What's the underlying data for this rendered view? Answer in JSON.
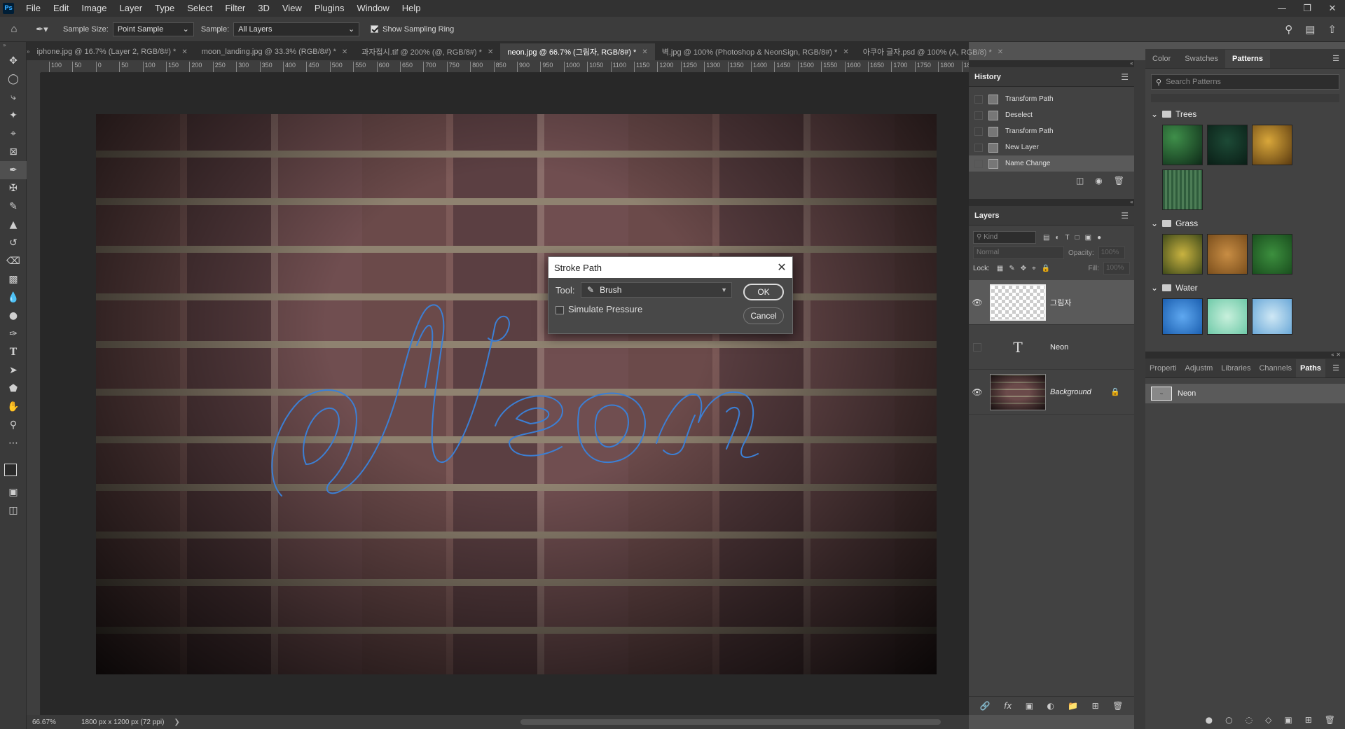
{
  "app": {
    "logo": "Ps"
  },
  "menu": [
    "File",
    "Edit",
    "Image",
    "Layer",
    "Type",
    "Select",
    "Filter",
    "3D",
    "View",
    "Plugins",
    "Window",
    "Help"
  ],
  "options": {
    "sample_size_label": "Sample Size:",
    "sample_size_value": "Point Sample",
    "sample_label": "Sample:",
    "sample_value": "All Layers",
    "show_sampling_ring": "Show Sampling Ring"
  },
  "tabs": [
    {
      "label": "iphone.jpg @ 16.7% (Layer 2, RGB/8#) *"
    },
    {
      "label": "moon_landing.jpg @ 33.3% (RGB/8#) *"
    },
    {
      "label": "과자접시.tif @ 200% (@, RGB/8#) *"
    },
    {
      "label": "neon.jpg @ 66.7% (그림자, RGB/8#) *"
    },
    {
      "label": "벽.jpg @ 100% (Photoshop & NeonSign, RGB/8#) *"
    },
    {
      "label": "아쿠아 글자.psd @ 100% (A, RGB/8) *"
    }
  ],
  "ruler_ticks": [
    "100",
    "50",
    "0",
    "50",
    "100",
    "150",
    "200",
    "250",
    "300",
    "350",
    "400",
    "450",
    "500",
    "550",
    "600",
    "650",
    "700",
    "750",
    "800",
    "850",
    "900",
    "950",
    "1000",
    "1050",
    "1100",
    "1150",
    "1200",
    "1250",
    "1300",
    "1350",
    "1400",
    "1450",
    "1500",
    "1550",
    "1600",
    "1650",
    "1700",
    "1750",
    "1800",
    "18"
  ],
  "status": {
    "zoom": "66.67%",
    "doc_size": "1800 px x 1200 px (72 ppi)"
  },
  "history": {
    "title": "History",
    "items": [
      "Transform Path",
      "Deselect",
      "Transform Path",
      "New Layer",
      "Name Change"
    ]
  },
  "layers": {
    "title": "Layers",
    "kind": "Kind",
    "blend_mode": "Normal",
    "opacity_label": "Opacity:",
    "opacity_value": "100%",
    "lock_label": "Lock:",
    "fill_label": "Fill:",
    "fill_value": "100%",
    "items": [
      {
        "name": "그림자"
      },
      {
        "name": "Neon"
      },
      {
        "name": "Background"
      }
    ]
  },
  "right_top_tabs": [
    "Color",
    "Swatches",
    "Patterns"
  ],
  "patterns": {
    "search_placeholder": "Search Patterns",
    "groups": [
      "Trees",
      "Grass",
      "Water"
    ]
  },
  "right_bottom_tabs": [
    "Properti",
    "Adjustm",
    "Libraries",
    "Channels",
    "Paths"
  ],
  "paths": {
    "items": [
      "Neon"
    ]
  },
  "dialog": {
    "title": "Stroke Path",
    "tool_label": "Tool:",
    "tool_value": "Brush",
    "simulate_pressure": "Simulate Pressure",
    "ok": "OK",
    "cancel": "Cancel"
  },
  "colors": {
    "accent_path": "#3c7fd4",
    "panel_bg": "#424242",
    "selected_row": "#5a5a5a"
  }
}
